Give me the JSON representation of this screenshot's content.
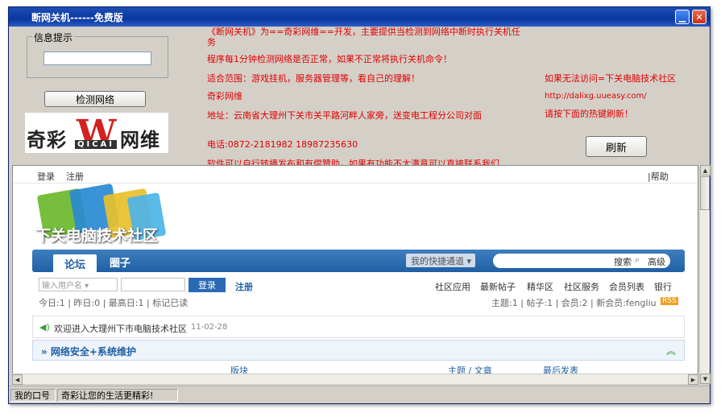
{
  "window": {
    "title": "断网关机------免费版",
    "minimize_symbol": "▁",
    "close_symbol": "✕"
  },
  "panel": {
    "group_label": "信息提示",
    "info_value": "",
    "detect_button": "检测网络",
    "refresh_button": "刷新",
    "logo_text_cn_left": "奇彩",
    "logo_letter": "W",
    "logo_text_cn_right": "网维",
    "logo_sub": "QICAI",
    "info_lines": [
      "《断网关机》为==奇彩网维==开发，主要提供当检测到网络中断时执行关机任务",
      "程序每1分钟检测网络是否正常，如果不正常将执行关机命令！",
      "适合范围：游戏挂机，服务器管理等，看自己的理解！",
      "奇彩网维",
      "地址：云南省大理州下关市关平路河畔人家旁，送变电工程分公司对面",
      "电话:0872-2181982 18987235630",
      "软件可以自行转播发布和有偿赞助，如果有功能不太满意可以直接联系我们"
    ],
    "right_lines": [
      "如果无法访问=下关电脑技术社区",
      "http://dalixg.uueasy.com/",
      "请按下面的热键刷新！"
    ]
  },
  "web": {
    "login_link": "登录",
    "register_link": "注册",
    "help_link": "|帮助",
    "banner_title": "下关电脑技术社区",
    "nav_forum": "论坛",
    "nav_circle": "圈子",
    "quick_channel": "我的快捷通道 ▾",
    "search_label": "搜索",
    "advanced_label": "高级",
    "username_placeholder": "输入用户名 ▾",
    "login_button": "登录",
    "register_button": "注册",
    "menu_items": [
      "社区应用",
      "最新帖子",
      "精华区",
      "社区服务",
      "会员列表",
      "银行"
    ],
    "stats_left": "今日:1 | 昨日:0 | 最高日:1 | 标记已读",
    "stats_right": "主题:1 | 帖子:1 | 会员:2 | 新会员:fengliu",
    "rss_badge": "RSS",
    "welcome_text": "欢迎进入大理州下市电脑技术社区",
    "welcome_date": "11-02-28",
    "section_title": "» 网络安全+系统维护",
    "col_board": "版块",
    "col_topics": "主题 / 文章",
    "col_last": "最后发表"
  },
  "status": {
    "cell1": "我的口号",
    "cell2": "奇彩让您的生活更精彩!"
  },
  "colors": {
    "titlebar": "#0a36a0",
    "info_text": "#e00000",
    "forum_blue": "#1f5fa4"
  }
}
